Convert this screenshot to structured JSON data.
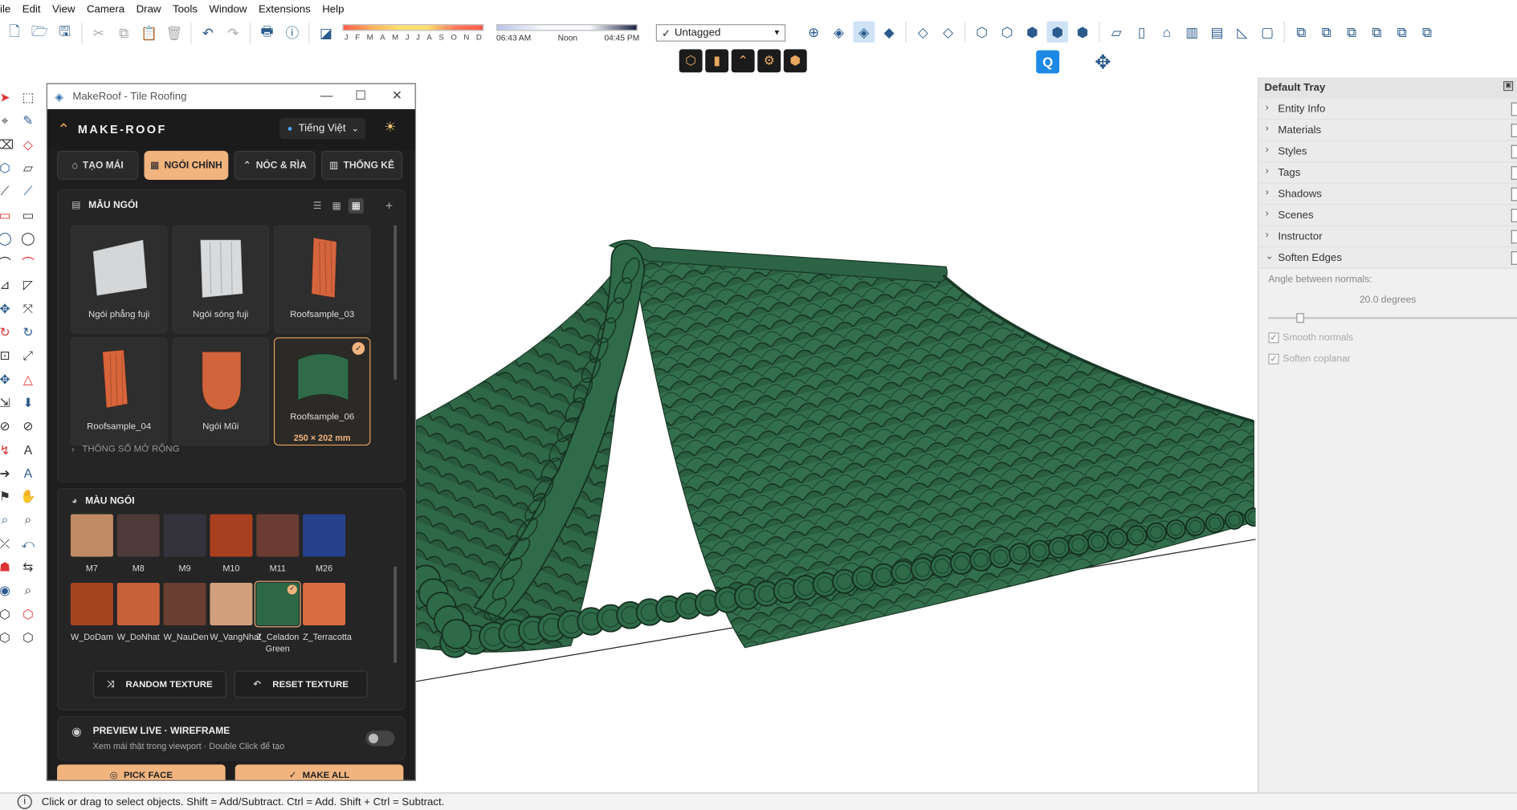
{
  "menu": [
    "ile",
    "Edit",
    "View",
    "Camera",
    "Draw",
    "Tools",
    "Window",
    "Extensions",
    "Help"
  ],
  "shadow": {
    "months": [
      "J",
      "F",
      "M",
      "A",
      "M",
      "J",
      "J",
      "A",
      "S",
      "O",
      "N",
      "D"
    ],
    "time_start": "06:43 AM",
    "time_mid": "Noon",
    "time_end": "04:45 PM"
  },
  "tag_select": {
    "value": "Untagged",
    "check": "✓"
  },
  "plugin": {
    "window_title": "MakeRoof - Tile Roofing",
    "brand": "MAKE-ROOF",
    "language": "Tiếng Việt",
    "tabs": [
      {
        "label": "TẠO MÁI",
        "icon": "home-icon",
        "active": false
      },
      {
        "label": "NGÓI CHÍNH",
        "icon": "grid-icon",
        "active": true
      },
      {
        "label": "NÓC & RÌA",
        "icon": "caret-up-icon",
        "active": false
      },
      {
        "label": "THỐNG KÊ",
        "icon": "stats-icon",
        "active": false
      }
    ],
    "tile_section_title": "MẪU NGÓI",
    "tiles": [
      {
        "label": "Ngói phẳng fuji",
        "selected": false,
        "color": "#d4d6d8"
      },
      {
        "label": "Ngói sóng fuji",
        "selected": false,
        "color": "#d8dadc"
      },
      {
        "label": "Roofsample_03",
        "selected": false,
        "color": "#d6653e"
      },
      {
        "label": "Roofsample_04",
        "selected": false,
        "color": "#d9653b"
      },
      {
        "label": "Ngói Mũi",
        "selected": false,
        "color": "#d2643c"
      },
      {
        "label": "Roofsample_06",
        "selected": true,
        "color": "#2f6b48",
        "dimension": "250 × 202 mm"
      }
    ],
    "extended_params": "THÔNG SỐ MỞ RỘNG",
    "color_section_title": "MÀU NGÓI",
    "colors_row1": [
      {
        "name": "M7",
        "color": "#c08a64"
      },
      {
        "name": "M8",
        "color": "#4e3a38"
      },
      {
        "name": "M9",
        "color": "#34333c"
      },
      {
        "name": "M10",
        "color": "#a8401f"
      },
      {
        "name": "M11",
        "color": "#6b3c34"
      },
      {
        "name": "M26",
        "color": "#26418c"
      }
    ],
    "colors_row2": [
      {
        "name": "W_DoDam",
        "color": "#a5451f",
        "selected": false
      },
      {
        "name": "W_DoNhat",
        "color": "#c8603c",
        "selected": false
      },
      {
        "name": "W_NauDen",
        "color": "#6a3e30",
        "selected": false
      },
      {
        "name": "W_VangNhat",
        "color": "#d2a07c",
        "selected": false
      },
      {
        "name": "Z_Celadon Green",
        "color": "#2d6846",
        "selected": true
      },
      {
        "name": "Z_Terracotta",
        "color": "#d86d40",
        "selected": false
      }
    ],
    "random_texture": "RANDOM TEXTURE",
    "reset_texture": "RESET TEXTURE",
    "preview_title": "PREVIEW LIVE · WIREFRAME",
    "preview_desc": "Xem mái thật trong viewport · Double Click để tạo",
    "preview_enabled": false,
    "pick_face": "PICK FACE",
    "make_all": "MAKE ALL"
  },
  "tray": {
    "title": "Default Tray",
    "sections": [
      "Entity Info",
      "Materials",
      "Styles",
      "Tags",
      "Shadows",
      "Scenes",
      "Instructor"
    ],
    "open_section": "Soften Edges",
    "angle_label": "Angle between normals:",
    "angle_value": "20.0  degrees",
    "angle_fraction": 0.11,
    "smooth_normals": "Smooth normals",
    "soften_coplanar": "Soften coplanar"
  },
  "status": {
    "text": "Click or drag to select objects. Shift = Add/Subtract. Ctrl = Add. Shift + Ctrl = Subtract."
  },
  "colors": {
    "accent": "#f1b47f",
    "roof_green": "#2e6b48",
    "plugin_bg": "#1e1e1e"
  }
}
